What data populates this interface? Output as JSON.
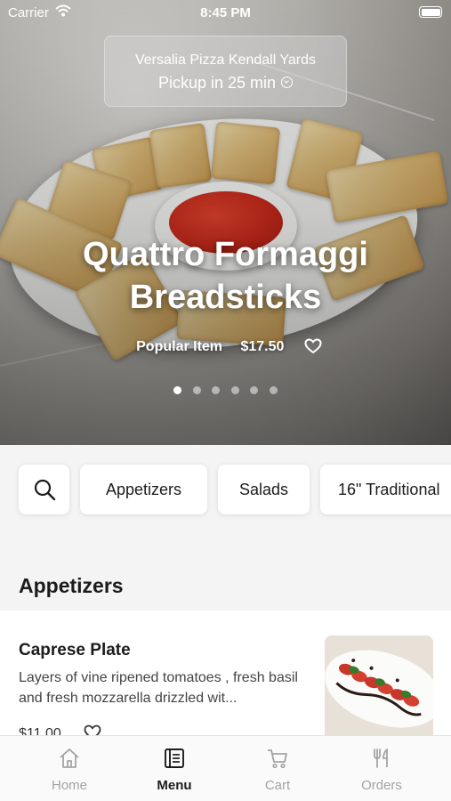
{
  "status_bar": {
    "carrier": "Carrier",
    "time": "8:45 PM"
  },
  "pickup": {
    "store": "Versalia Pizza Kendall Yards",
    "eta": "Pickup in 25 min"
  },
  "hero": {
    "title_line1": "Quattro Formaggi",
    "title_line2": "Breadsticks",
    "tag": "Popular Item",
    "price": "$17.50",
    "slide_count": 6,
    "active_slide": 0
  },
  "categories": [
    "Appetizers",
    "Salads",
    "16\" Traditional"
  ],
  "section": {
    "title": "Appetizers"
  },
  "menu_items": [
    {
      "name": "Caprese Plate",
      "description": "Layers of vine ripened tomatoes , fresh basil and fresh mozzarella drizzled wit...",
      "price": "$11.00"
    }
  ],
  "tabs": [
    {
      "label": "Home",
      "icon": "home-icon",
      "active": false
    },
    {
      "label": "Menu",
      "icon": "menu-book-icon",
      "active": true
    },
    {
      "label": "Cart",
      "icon": "cart-icon",
      "active": false
    },
    {
      "label": "Orders",
      "icon": "fork-knife-icon",
      "active": false
    }
  ],
  "colors": {
    "active_tab": "#1c1c1c",
    "inactive_tab": "#a3a3a3",
    "sauce": "#c7281a"
  }
}
